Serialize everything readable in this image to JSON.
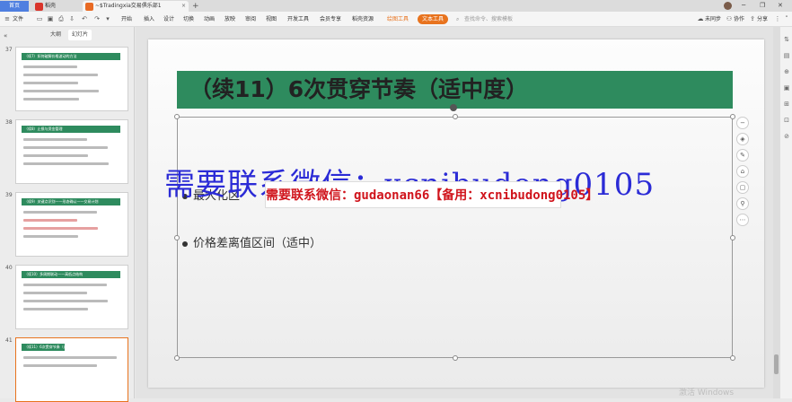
{
  "tabs": {
    "home": "首页",
    "daoke": "稻壳",
    "doc": "~$Tradingxia交易俱乐部1",
    "close": "×",
    "new_tab": "+"
  },
  "window": {
    "minimize": "─",
    "restore": "❐",
    "close": "✕"
  },
  "toolbar": {
    "menu_icon": "≡",
    "file_label": "文件",
    "menus": [
      "开始",
      "插入",
      "设计",
      "切换",
      "动画",
      "放映",
      "审阅",
      "视图",
      "开发工具",
      "会员专享",
      "稻壳资源"
    ],
    "design_pill": "绘图工具",
    "text_pill": "文本工具",
    "search_placeholder": "查找命令、搜索模板",
    "sync": "未同步",
    "collab": "协作",
    "share": "分享"
  },
  "panel": {
    "collapse": "«",
    "tabs": [
      "大纲",
      "幻灯片"
    ]
  },
  "thumbnails": [
    {
      "num": "37",
      "title": "（续7）如何破解价格波动的方法"
    },
    {
      "num": "38",
      "title": "（续8）止损与资金管理"
    },
    {
      "num": "39",
      "title": "（续9）关键点识别——形态确认——交易计划"
    },
    {
      "num": "40",
      "title": "（续10）多周期联动——高低点结构"
    },
    {
      "num": "41",
      "title": "（续11）6次贯穿节奏（适中度）"
    }
  ],
  "slide": {
    "title": "（续11）6次贯穿节奏（适中度）",
    "bullets": [
      "最大化区",
      "价格差离值区间（适中）"
    ]
  },
  "watermarks": {
    "big": "需要联系微信：xcnibudong0105",
    "box": "需要联系微信：gudaonan66【备用：xcnibudong0105】"
  },
  "float_tools": [
    "−",
    "◈",
    "✎",
    "⌂",
    "▢",
    "⚲",
    "⋯"
  ],
  "right_rail": [
    "⇅",
    "▤",
    "⊕",
    "▣",
    "⊞",
    "⊡",
    "⊘"
  ],
  "activation": "激活 Windows"
}
